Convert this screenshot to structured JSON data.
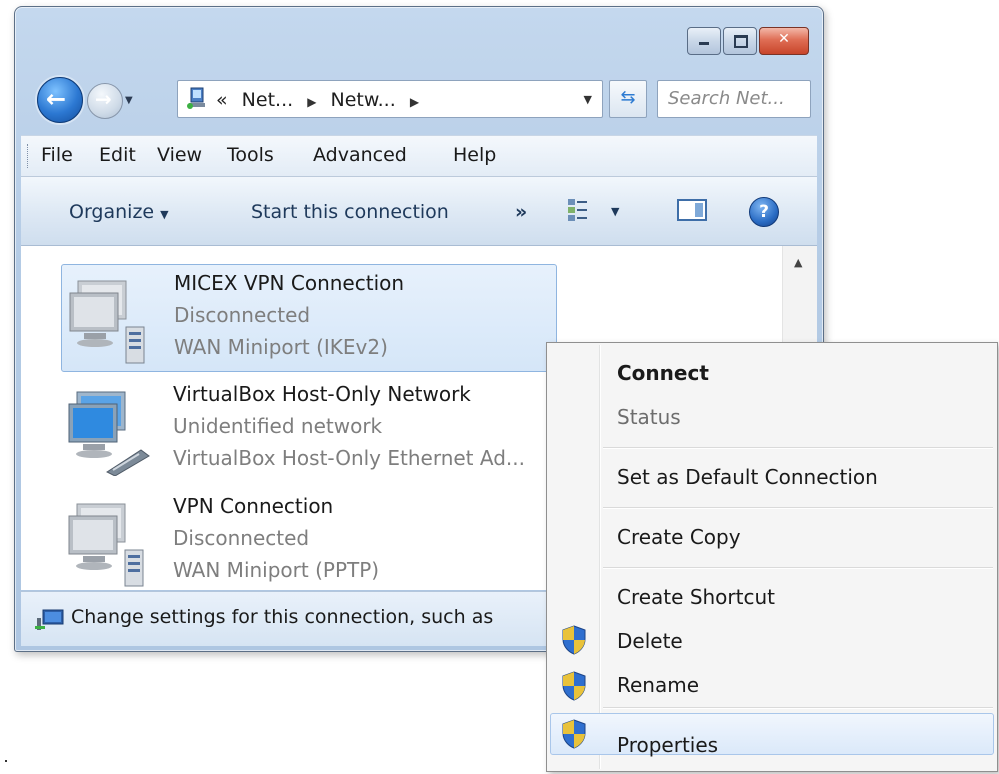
{
  "window": {
    "address_parts": [
      "Net...",
      "Netw..."
    ],
    "address_prefix": "«",
    "search_placeholder": "Search Net...",
    "caption": {
      "minimize": "",
      "maximize": "",
      "close": "✕"
    }
  },
  "menubar": {
    "items": [
      "File",
      "Edit",
      "View",
      "Tools",
      "Advanced",
      "Help"
    ]
  },
  "cmdbar": {
    "organize": "Organize",
    "start_connection": "Start this connection",
    "more": "»"
  },
  "connections": [
    {
      "name": "MICEX VPN Connection",
      "status": "Disconnected",
      "device": "WAN Miniport (IKEv2)",
      "type": "vpn",
      "selected": true
    },
    {
      "name": "VirtualBox Host-Only Network",
      "status": "Unidentified network",
      "device": "VirtualBox Host-Only Ethernet Ad...",
      "type": "lan",
      "selected": false
    },
    {
      "name": "VPN Connection",
      "status": "Disconnected",
      "device": "WAN Miniport (PPTP)",
      "type": "vpn",
      "selected": false
    }
  ],
  "statusbar": {
    "text": "Change settings for this connection, such as"
  },
  "context_menu": {
    "connect": "Connect",
    "status": "Status",
    "set_default": "Set as Default Connection",
    "create_copy": "Create Copy",
    "create_shortcut": "Create Shortcut",
    "delete": "Delete",
    "rename": "Rename",
    "properties": "Properties"
  },
  "colors": {
    "accent": "#2c78d2",
    "selection": "#d5e6f8",
    "disabled_text": "#7e7e7e"
  }
}
